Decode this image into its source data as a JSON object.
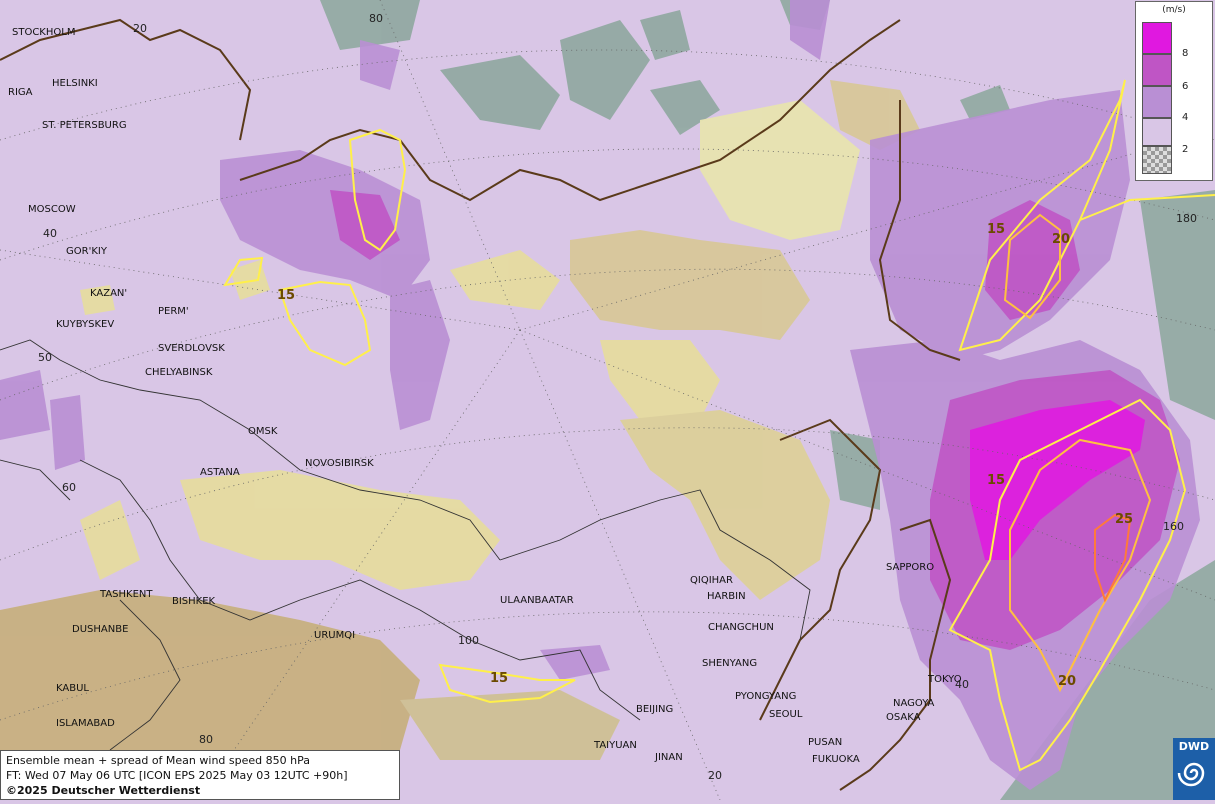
{
  "map": {
    "cities": [
      {
        "name": "STOCKHOLM"
      },
      {
        "name": "HELSINKI"
      },
      {
        "name": "RIGA"
      },
      {
        "name": "ST. PETERSBURG"
      },
      {
        "name": "MOSCOW"
      },
      {
        "name": "GOR'KIY"
      },
      {
        "name": "KAZAN'"
      },
      {
        "name": "PERM'"
      },
      {
        "name": "KUYBYSKEV"
      },
      {
        "name": "SVERDLOVSK"
      },
      {
        "name": "CHELYABINSK"
      },
      {
        "name": "OMSK"
      },
      {
        "name": "NOVOSIBIRSK"
      },
      {
        "name": "ASTANA"
      },
      {
        "name": "TASHKENT"
      },
      {
        "name": "BISHKEK"
      },
      {
        "name": "DUSHANBE"
      },
      {
        "name": "URUMQI"
      },
      {
        "name": "KABUL"
      },
      {
        "name": "ISLAMABAD"
      },
      {
        "name": "ULAANBAATAR"
      },
      {
        "name": "QIQIHAR"
      },
      {
        "name": "HARBIN"
      },
      {
        "name": "CHANGCHUN"
      },
      {
        "name": "SHENYANG"
      },
      {
        "name": "PYONGYANG"
      },
      {
        "name": "SEOUL"
      },
      {
        "name": "BEIJING"
      },
      {
        "name": "TAIYUAN"
      },
      {
        "name": "JINAN"
      },
      {
        "name": "PUSAN"
      },
      {
        "name": "FUKUOKA"
      },
      {
        "name": "OSAKA"
      },
      {
        "name": "NAGOYA"
      },
      {
        "name": "TOKYO"
      },
      {
        "name": "SAPPORO"
      }
    ],
    "grid_labels": [
      "20",
      "80",
      "40",
      "50",
      "60",
      "100",
      "80",
      "20",
      "180",
      "160",
      "40"
    ],
    "contour_labels": [
      "15",
      "15",
      "15",
      "20",
      "15",
      "20",
      "25",
      "15"
    ],
    "colors": {
      "base": "#d9c6e6",
      "level_4_6": "#b98fd4",
      "level_6_8": "#bf55c5",
      "level_8_plus": "#e018e0",
      "sea": "#8fa8a0",
      "terrain": "#e6dca0",
      "contour_15": "#fff04a",
      "contour_20": "#ffc040",
      "contour_25": "#ff7a3a",
      "coast": "#f0a050"
    }
  },
  "legend": {
    "unit": "(m/s)",
    "levels": [
      {
        "label": "8",
        "color": "#e018e0"
      },
      {
        "label": "6",
        "color": "#bf55c5"
      },
      {
        "label": "4",
        "color": "#b98fd4"
      },
      {
        "label": "2",
        "color": "#d9c6e6"
      }
    ],
    "bottom_swatch_color": "checker"
  },
  "info": {
    "line1": "Ensemble mean + spread of Mean wind speed 850 hPa",
    "line2": "FT: Wed 07 May 06 UTC [ICON EPS 2025 May 03 12UTC +90h]",
    "line3": "©2025 Deutscher Wetterdienst"
  },
  "logo": {
    "text": "DWD",
    "icon": "dwd-spiral-icon"
  }
}
